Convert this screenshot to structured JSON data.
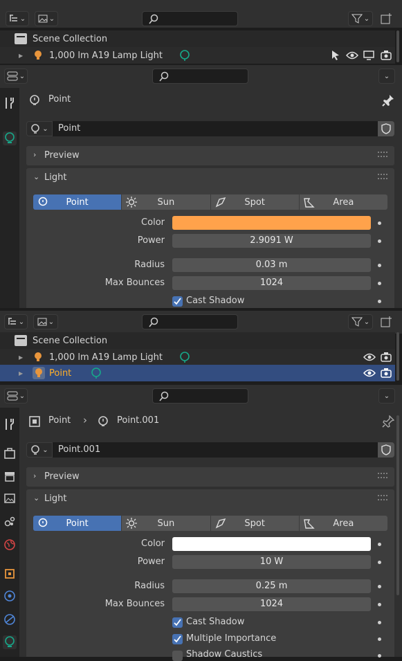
{
  "outliner1": {
    "items": [
      {
        "label": "Scene Collection"
      },
      {
        "label": "1,000 lm A19 Lamp Light"
      }
    ]
  },
  "props1": {
    "context_label": "Point",
    "name_value": "Point",
    "preview_label": "Preview",
    "light_label": "Light",
    "types": [
      "Point",
      "Sun",
      "Spot",
      "Area"
    ],
    "color_label": "Color",
    "color_value": "#ffa24b",
    "power_label": "Power",
    "power_value": "2.9091 W",
    "radius_label": "Radius",
    "radius_value": "0.03 m",
    "bounces_label": "Max Bounces",
    "bounces_value": "1024",
    "cast_shadow_label": "Cast Shadow"
  },
  "outliner2": {
    "items": [
      {
        "label": "Scene Collection"
      },
      {
        "label": "1,000 lm A19 Lamp Light"
      },
      {
        "label": "Point"
      }
    ]
  },
  "props2": {
    "breadcrumb_object": "Point",
    "breadcrumb_data": "Point.001",
    "name_value": "Point.001",
    "preview_label": "Preview",
    "light_label": "Light",
    "types": [
      "Point",
      "Sun",
      "Spot",
      "Area"
    ],
    "color_label": "Color",
    "color_value": "#ffffff",
    "power_label": "Power",
    "power_value": "10 W",
    "radius_label": "Radius",
    "radius_value": "0.25 m",
    "bounces_label": "Max Bounces",
    "bounces_value": "1024",
    "cast_shadow_label": "Cast Shadow",
    "mis_label": "Multiple Importance",
    "caustics_label": "Shadow Caustics"
  },
  "colors": {
    "accent": "#4772b3",
    "selected_row": "#334d80",
    "light_green": "#17a88a",
    "lamp_orange": "#e8953c"
  }
}
